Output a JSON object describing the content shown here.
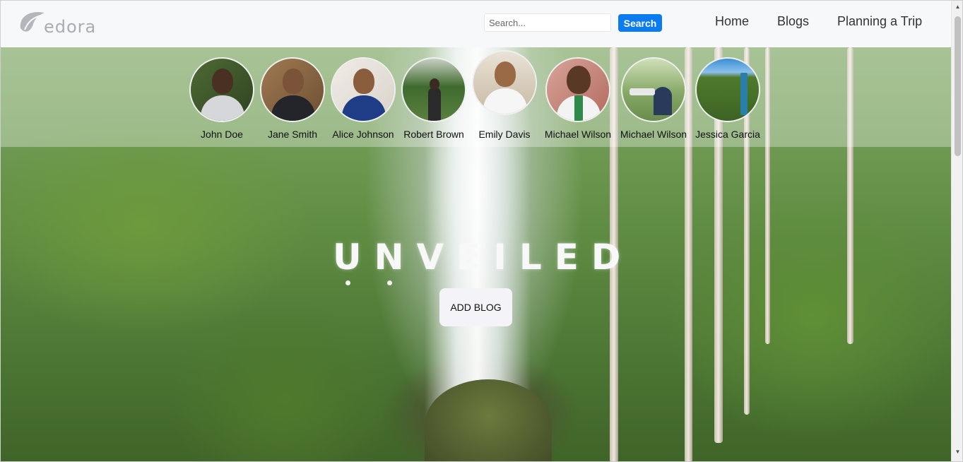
{
  "brand": {
    "logo_text": "edora"
  },
  "search": {
    "placeholder": "Search...",
    "button_label": "Search"
  },
  "nav": {
    "items": [
      "Home",
      "Blogs",
      "Planning a Trip"
    ]
  },
  "profiles": [
    {
      "name": "John Doe"
    },
    {
      "name": "Jane Smith"
    },
    {
      "name": "Alice Johnson"
    },
    {
      "name": "Robert Brown"
    },
    {
      "name": "Emily Davis"
    },
    {
      "name": "Michael Wilson"
    },
    {
      "name": "Michael Wilson"
    },
    {
      "name": "Jessica Garcia"
    }
  ],
  "hero": {
    "title": "UNVEILED",
    "cta_label": "ADD BLOG"
  },
  "colors": {
    "search_button": "#0a7cf0",
    "navbar_bg": "#f7f8fa",
    "cta_bg": "#f4f3f8"
  }
}
